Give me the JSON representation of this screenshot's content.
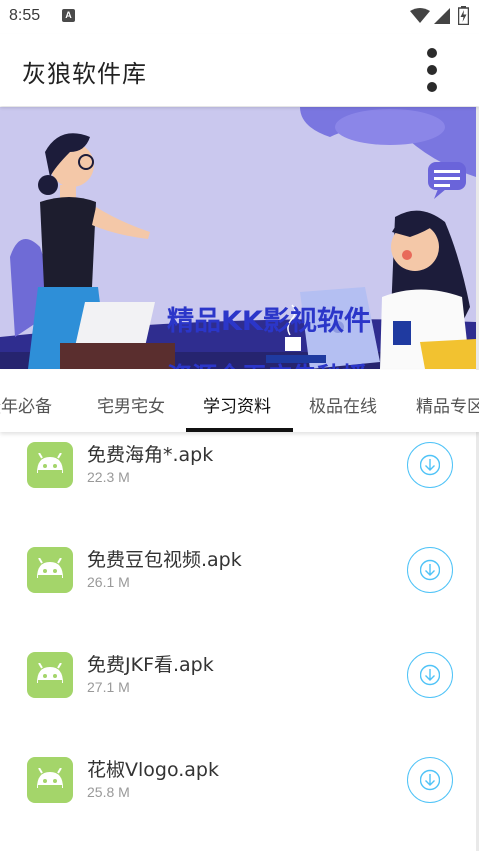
{
  "status_bar": {
    "time": "8:55",
    "notification_icon": "a-letter-icon",
    "icons": [
      "wifi-icon",
      "signal-icon",
      "battery-charging-icon"
    ]
  },
  "app_bar": {
    "title": "灰狼软件库",
    "menu_icon": "more-vert-icon"
  },
  "banner": {
    "line1": "精品KK影视软件",
    "line2": "资源全无广告秒播",
    "background_color": "#c9c7ec",
    "text_color": "#2b36c9"
  },
  "tabs": [
    {
      "label": "骚年必备",
      "active": false
    },
    {
      "label": "宅男宅女",
      "active": false
    },
    {
      "label": "学习资料",
      "active": true
    },
    {
      "label": "极品在线",
      "active": false
    },
    {
      "label": "精品专区",
      "active": false
    }
  ],
  "files": [
    {
      "name": "免费海角*.apk",
      "size": "22.3 M",
      "icon": "android-icon",
      "action_icon": "download-icon"
    },
    {
      "name": "免费豆包视频.apk",
      "size": "26.1 M",
      "icon": "android-icon",
      "action_icon": "download-icon"
    },
    {
      "name": "免费JKF看.apk",
      "size": "27.1 M",
      "icon": "android-icon",
      "action_icon": "download-icon"
    },
    {
      "name": "花椒Vlogo.apk",
      "size": "25.8 M",
      "icon": "android-icon",
      "action_icon": "download-icon"
    }
  ],
  "colors": {
    "android_green": "#a4d56a",
    "download_blue": "#4fc3f7",
    "tab_indicator": "#111111"
  }
}
